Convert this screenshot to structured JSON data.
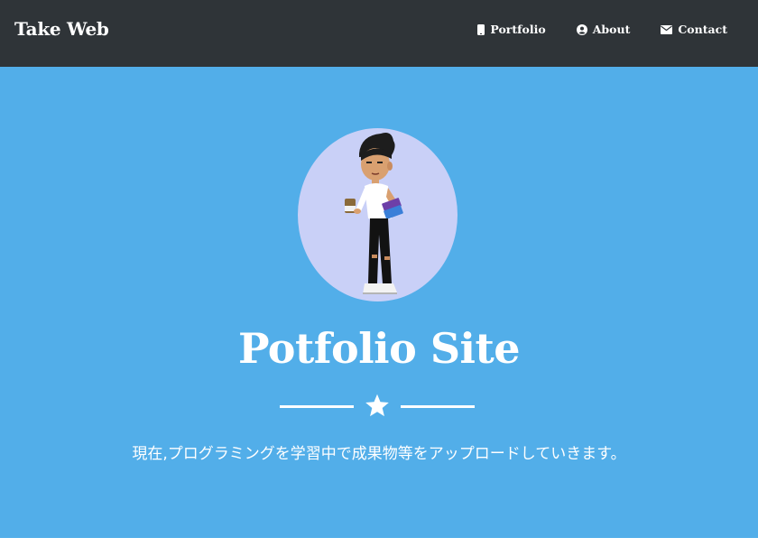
{
  "nav": {
    "brand": "Take Web",
    "items": [
      {
        "label": "Portfolio",
        "icon": "mobile-icon"
      },
      {
        "label": "About",
        "icon": "user-circle-icon"
      },
      {
        "label": "Contact",
        "icon": "envelope-icon"
      }
    ]
  },
  "hero": {
    "avatar_description_icon": "cartoon-avatar-icon",
    "title": "Potfolio Site",
    "divider_icon": "star-icon",
    "subtitle": "現在,プログラミングを学習中で成果物等をアップロードしていきます。"
  },
  "colors": {
    "navbar": "#2f3438",
    "hero_background": "#52aee9",
    "avatar_background": "#c9d0f7",
    "text": "#ffffff"
  }
}
